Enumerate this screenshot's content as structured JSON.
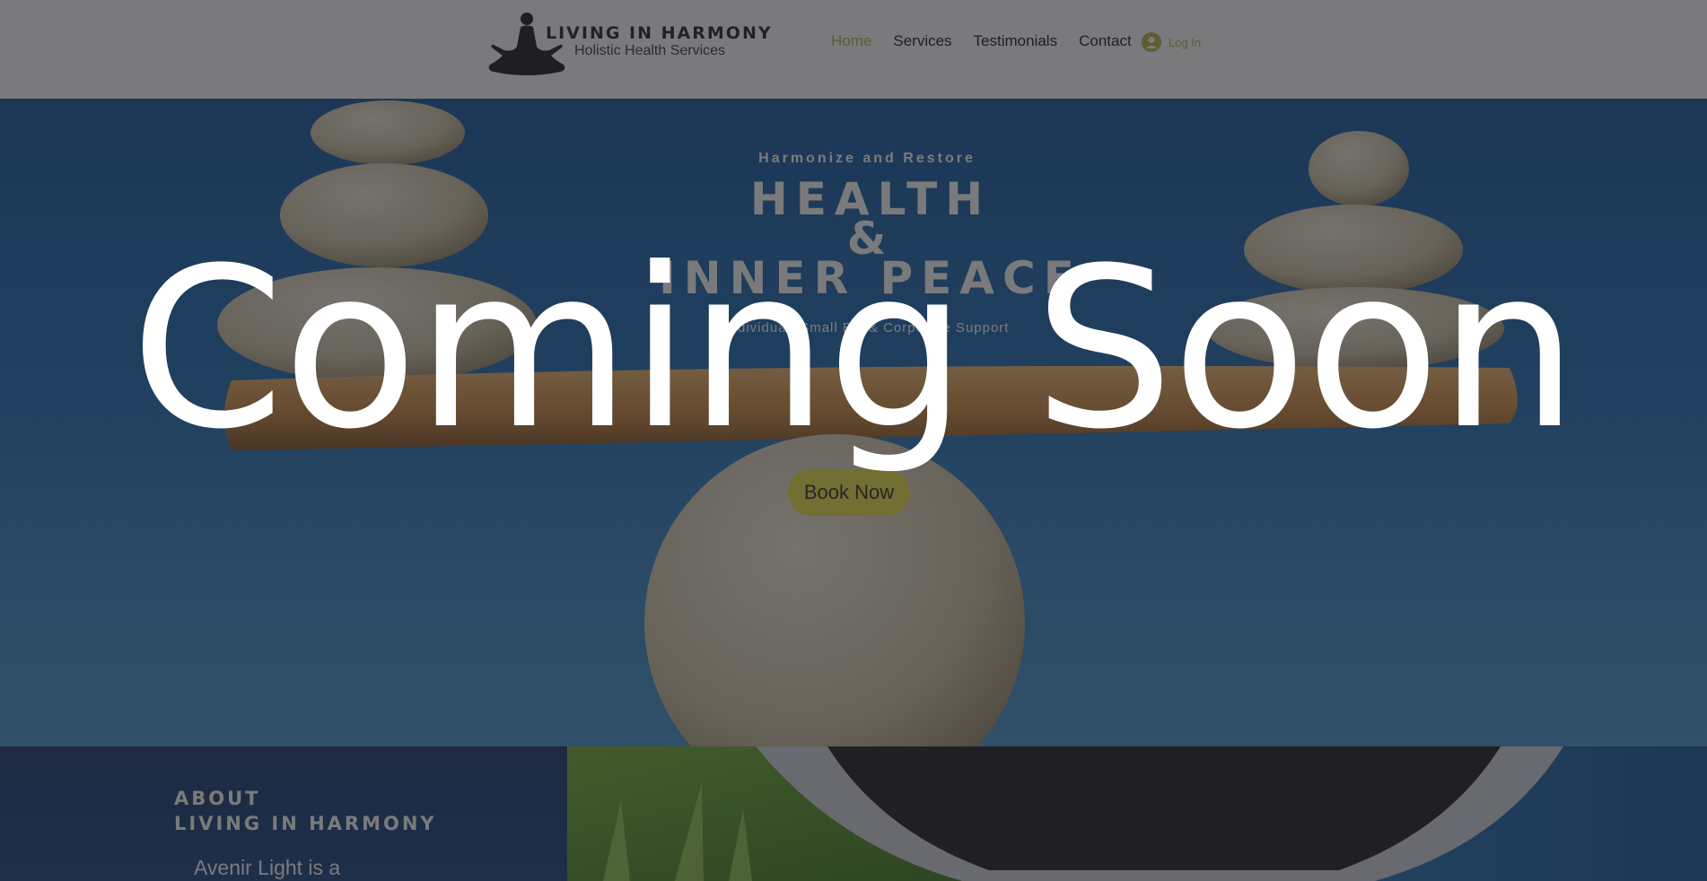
{
  "brand": {
    "title": "LIVING IN HARMONY",
    "subtitle": "Holistic Health Services",
    "logo_icon": "meditation-figure-icon"
  },
  "nav": {
    "items": [
      "Home",
      "Services",
      "Testimonials",
      "Contact"
    ],
    "active": "Home",
    "accent_color": "#b5b13c"
  },
  "login": {
    "label": "Log In",
    "icon": "user-avatar-icon"
  },
  "hero": {
    "eyebrow": "Harmonize and Restore",
    "title_lines": [
      "HEALTH",
      "&",
      "INNER PEACE"
    ],
    "subtitle": "Individual, Small Biz & Corporate Support",
    "cta_label": "Book Now",
    "cta_color": "#e8e23a"
  },
  "about": {
    "heading_line1": "ABOUT",
    "heading_line2": "LIVING IN HARMONY",
    "text": "Avenir Light is a"
  },
  "overlay": {
    "message": "Coming Soon"
  }
}
